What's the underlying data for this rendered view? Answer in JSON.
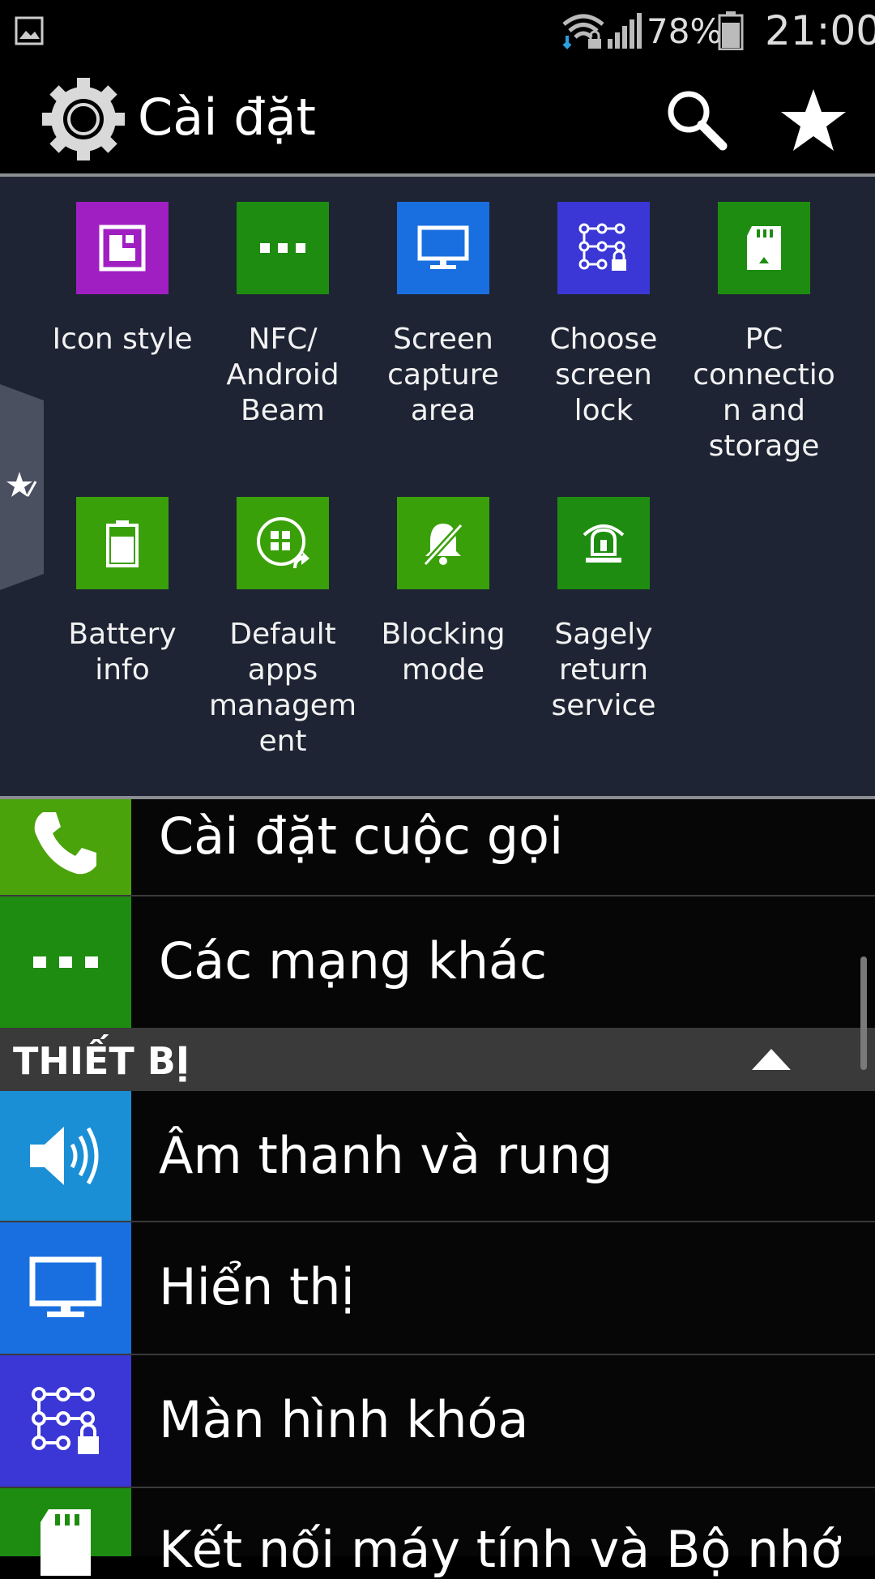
{
  "status_bar": {
    "battery_percent": "78%",
    "time": "21:00",
    "icons": [
      "gallery-notification-icon",
      "wifi-icon",
      "signal-icon",
      "battery-icon"
    ]
  },
  "action_bar": {
    "title": "Cài đặt",
    "icons": [
      "gear-icon",
      "search-icon",
      "star-icon"
    ]
  },
  "quick_settings": [
    {
      "label": "Icon style",
      "color": "#a01fc2",
      "icon": "icon-style-icon"
    },
    {
      "label": "NFC/\nAndroid\nBeam",
      "color": "#1e8c10",
      "icon": "nfc-dots-icon"
    },
    {
      "label": "Screen\ncapture\narea",
      "color": "#1a6fe0",
      "icon": "monitor-icon"
    },
    {
      "label": "Choose\nscreen\nlock",
      "color": "#3a37d6",
      "icon": "pattern-lock-icon"
    },
    {
      "label": "PC\nconnectio\nn and\nstorage",
      "color": "#1e8c10",
      "icon": "sd-card-icon"
    },
    {
      "label": "Battery\ninfo",
      "color": "#3aa00a",
      "icon": "battery-info-icon"
    },
    {
      "label": "Default\napps\nmanagem\nent",
      "color": "#3aa00a",
      "icon": "default-apps-icon"
    },
    {
      "label": "Blocking\nmode",
      "color": "#3aa00a",
      "icon": "bell-off-icon"
    },
    {
      "label": "Sagely\nreturn\nservice",
      "color": "#1e8c10",
      "icon": "siren-icon"
    }
  ],
  "list": {
    "rows_top": [
      {
        "label": "Cài đặt cuộc gọi",
        "color": "#4aa30a",
        "icon": "phone-icon"
      },
      {
        "label": "Các mạng khác",
        "color": "#1e8c10",
        "icon": "more-dots-icon"
      }
    ],
    "section": {
      "label": "THIẾT BỊ",
      "icon": "collapse-triangle-icon"
    },
    "rows_bottom": [
      {
        "label": "Âm thanh và rung",
        "color": "#1a8fd6",
        "icon": "speaker-icon"
      },
      {
        "label": "Hiển thị",
        "color": "#1a6fe0",
        "icon": "monitor-icon"
      },
      {
        "label": "Màn hình khóa",
        "color": "#3a37d6",
        "icon": "pattern-lock-icon"
      },
      {
        "label": "Kết nối máy tính và Bộ nhớ",
        "color": "#1e8c10",
        "icon": "sd-card-icon"
      }
    ]
  }
}
